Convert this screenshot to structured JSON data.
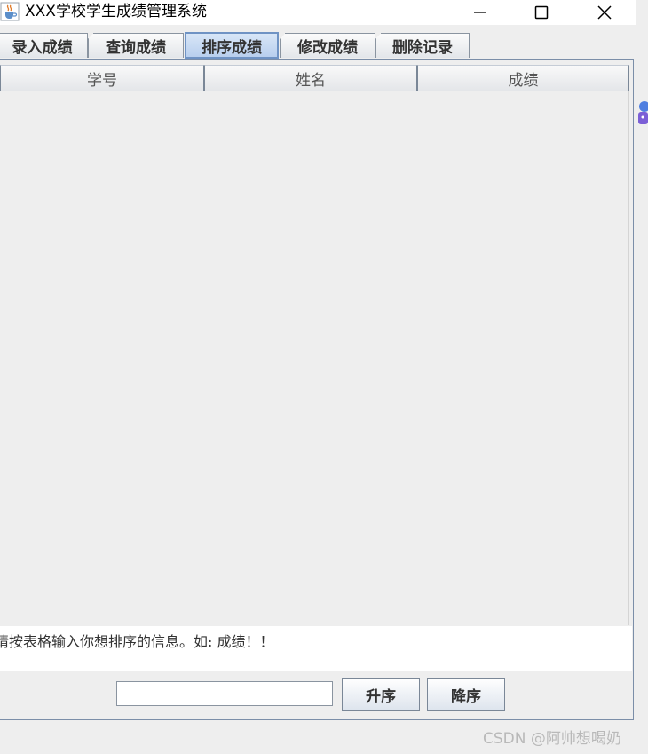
{
  "window": {
    "title": "XXX学校学生成绩管理系统"
  },
  "tabs": [
    {
      "label": "录入成绩"
    },
    {
      "label": "查询成绩"
    },
    {
      "label": "排序成绩",
      "selected": true
    },
    {
      "label": "修改成绩"
    },
    {
      "label": "删除记录"
    }
  ],
  "table": {
    "columns": [
      "学号",
      "姓名",
      "成绩"
    ],
    "rows": []
  },
  "hint": "请按表格输入你想排序的信息。如: 成绩！！",
  "controls": {
    "input_value": "",
    "asc_label": "升序",
    "desc_label": "降序"
  },
  "watermark": "CSDN @阿帅想喝奶",
  "icons": {
    "app": "java-cup-icon",
    "minimize": "minimize-icon",
    "maximize": "maximize-icon",
    "close": "close-icon"
  },
  "colors": {
    "selected_tab": "#b8cfee",
    "panel_border": "#7b8ea8"
  }
}
